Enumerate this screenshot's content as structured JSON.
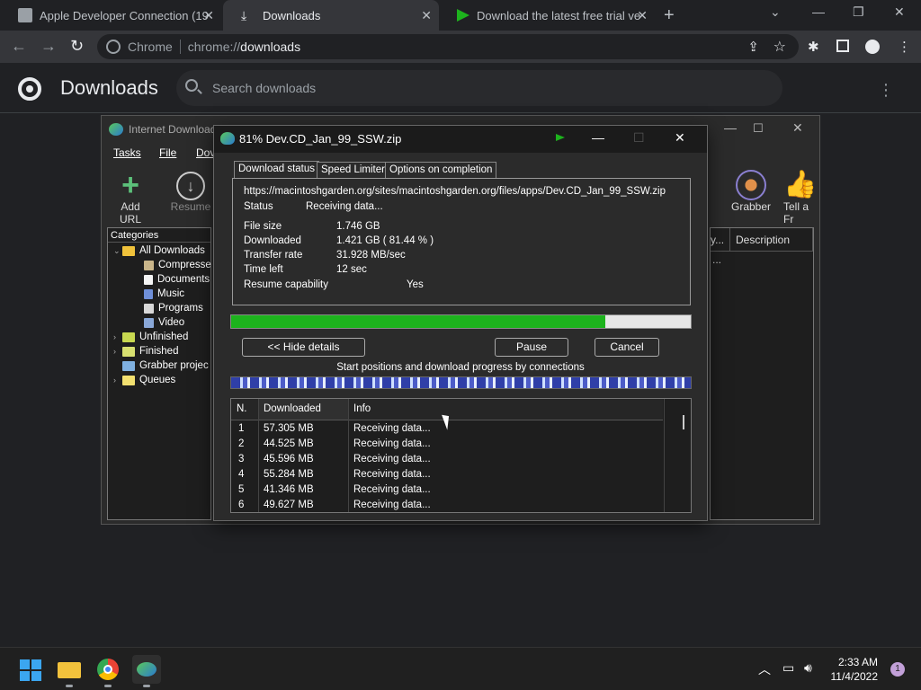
{
  "browser": {
    "tabs": [
      {
        "title": "Apple Developer Connection (19",
        "active": false
      },
      {
        "title": "Downloads",
        "active": true
      },
      {
        "title": "Download the latest free trial ve",
        "active": false
      }
    ],
    "omnibox": {
      "label": "Chrome",
      "scheme": "chrome://",
      "host": "downloads"
    }
  },
  "downloads_page": {
    "title": "Downloads",
    "search_placeholder": "Search downloads"
  },
  "idm_main": {
    "title": "Internet Download",
    "menu": [
      "Tasks",
      "File",
      "Dov"
    ],
    "tools": [
      {
        "label": "Add URL",
        "icon": "plus-icon"
      },
      {
        "label": "Resume",
        "icon": "download-circle-icon"
      },
      {
        "label": "Grabber",
        "icon": "grabber-icon"
      },
      {
        "label": "Tell a Fr",
        "icon": "thumbs-up-icon"
      }
    ],
    "categories_header": "Categories",
    "categories": [
      {
        "label": "All Downloads",
        "level": 0
      },
      {
        "label": "Compresse",
        "level": 1
      },
      {
        "label": "Documents",
        "level": 1
      },
      {
        "label": "Music",
        "level": 1
      },
      {
        "label": "Programs",
        "level": 1
      },
      {
        "label": "Video",
        "level": 1
      },
      {
        "label": "Unfinished",
        "level": 0
      },
      {
        "label": "Finished",
        "level": 0
      },
      {
        "label": "Grabber projec",
        "level": 0
      },
      {
        "label": "Queues",
        "level": 0
      }
    ],
    "list_columns": [
      "y...",
      "Description"
    ],
    "list_first_cell": "..."
  },
  "dialog": {
    "title": "81% Dev.CD_Jan_99_SSW.zip",
    "tabs": [
      "Download status",
      "Speed Limiter",
      "Options on completion"
    ],
    "url": "https://macintoshgarden.org/sites/macintoshgarden.org/files/apps/Dev.CD_Jan_99_SSW.zip",
    "status_label": "Status",
    "status_value": "Receiving data...",
    "file_size_label": "File size",
    "file_size_value": "1.746  GB",
    "downloaded_label": "Downloaded",
    "downloaded_value": "1.421  GB  ( 81.44 % )",
    "transfer_rate_label": "Transfer rate",
    "transfer_rate_value": "31.928  MB/sec",
    "time_left_label": "Time left",
    "time_left_value": "12 sec",
    "resume_label": "Resume capability",
    "resume_value": "Yes",
    "progress_fraction": 0.8144,
    "buttons": {
      "hide_details": "<< Hide details",
      "pause": "Pause",
      "cancel": "Cancel"
    },
    "connections_label": "Start positions and download progress by connections",
    "conn_columns": [
      "N.",
      "Downloaded",
      "Info"
    ],
    "connections": [
      {
        "n": "1",
        "downloaded": "57.305  MB",
        "info": "Receiving data..."
      },
      {
        "n": "2",
        "downloaded": "44.525  MB",
        "info": "Receiving data..."
      },
      {
        "n": "3",
        "downloaded": "45.596  MB",
        "info": "Receiving data..."
      },
      {
        "n": "4",
        "downloaded": "55.284  MB",
        "info": "Receiving data..."
      },
      {
        "n": "5",
        "downloaded": "41.346  MB",
        "info": "Receiving data..."
      },
      {
        "n": "6",
        "downloaded": "49.627  MB",
        "info": "Receiving data..."
      }
    ]
  },
  "taskbar": {
    "time": "2:33 AM",
    "date": "11/4/2022",
    "notifications": "1"
  },
  "colors": {
    "progress_green": "#1db31d",
    "folder_yellow": "#f0c23b",
    "chrome_bg": "#202124"
  }
}
